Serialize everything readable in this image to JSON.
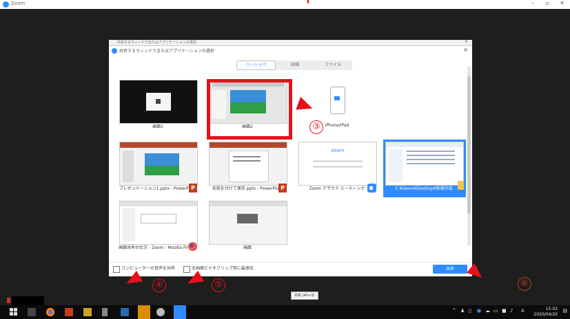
{
  "window": {
    "title": "Zoom"
  },
  "back_dialog": {
    "title": "共有するウィンドウまたはアプリケーションの選択"
  },
  "dialog": {
    "title": "共有するウィンドウまたはアプリケーションの選択",
    "close": "×",
    "tabs": [
      {
        "label": "ベーシック",
        "active": true
      },
      {
        "label": "詳細",
        "active": false
      },
      {
        "label": "ファイル",
        "active": false
      }
    ],
    "tiles": [
      {
        "label": "画面1",
        "kind": "screen"
      },
      {
        "label": "画面2",
        "kind": "screen"
      },
      {
        "label": "iPhone/iPad",
        "kind": "device"
      },
      {
        "label": "プレゼンテーション1.pptx - PowerPoint",
        "kind": "ppt"
      },
      {
        "label": "名前を付けて保存.pptx - PowerPoint",
        "kind": "ppt"
      },
      {
        "label": "Zoom クラウド ミーティング",
        "kind": "zoom",
        "thumb_text": "zoom"
      },
      {
        "label": "C:¥Users¥Desktop¥新規作成",
        "kind": "folder",
        "selected": true
      },
      {
        "label": "画面共有の仕方 - Zoom - Mozilla Firefox",
        "kind": "firefox"
      },
      {
        "label": "画面",
        "kind": "window"
      }
    ],
    "footer": {
      "sound_label": "コンピューターの音声を共有",
      "optimize_label": "全画面ビデオクリップ用に最適化",
      "share_button": "共有"
    }
  },
  "annotations": {
    "step3": "③",
    "step4": "④",
    "step5": "⑤",
    "step6": "⑥"
  },
  "tooltip": {
    "text": "共有 (Alt+S)"
  },
  "taskbar": {
    "clock_time": "15:02",
    "clock_date": "2020/04/20"
  },
  "colors": {
    "accent": "#2d8cff",
    "annotation_red": "#e8111b",
    "taskbar": "#0b0b0b",
    "background": "#1e1e1e"
  }
}
